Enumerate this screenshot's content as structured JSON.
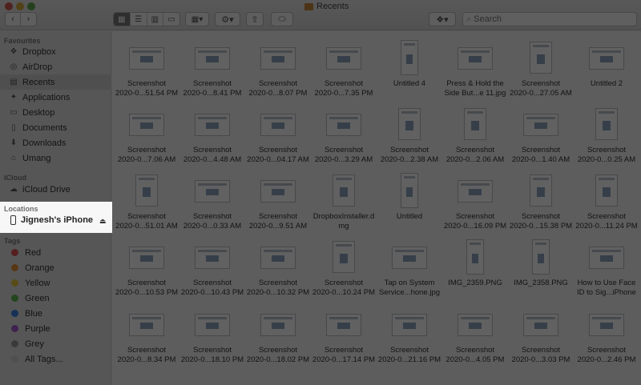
{
  "window": {
    "title": "Recents"
  },
  "toolbar": {
    "back": "‹",
    "forward": "›",
    "search_placeholder": "Search"
  },
  "sidebar": {
    "favourites_header": "Favourites",
    "favourites": [
      {
        "label": "Dropbox",
        "icon": "dropbox-icon"
      },
      {
        "label": "AirDrop",
        "icon": "airdrop-icon"
      },
      {
        "label": "Recents",
        "icon": "recents-icon"
      },
      {
        "label": "Applications",
        "icon": "applications-icon"
      },
      {
        "label": "Desktop",
        "icon": "desktop-icon"
      },
      {
        "label": "Documents",
        "icon": "documents-icon"
      },
      {
        "label": "Downloads",
        "icon": "downloads-icon"
      },
      {
        "label": "Umang",
        "icon": "home-icon"
      }
    ],
    "icloud_header": "iCloud",
    "icloud": [
      {
        "label": "iCloud Drive",
        "icon": "cloud-icon"
      }
    ],
    "locations_header": "Locations",
    "locations": [
      {
        "label": "Jignesh's iPhone",
        "icon": "phone-icon"
      }
    ],
    "tags_header": "Tags",
    "tags": [
      {
        "label": "Red",
        "color": "#e05252"
      },
      {
        "label": "Orange",
        "color": "#e8923a"
      },
      {
        "label": "Yellow",
        "color": "#e6c83a"
      },
      {
        "label": "Green",
        "color": "#5cb84c"
      },
      {
        "label": "Blue",
        "color": "#3a82e0"
      },
      {
        "label": "Purple",
        "color": "#a35ad0"
      },
      {
        "label": "Grey",
        "color": "#9a9a9a"
      },
      {
        "label": "All Tags...",
        "color": "#d0d0d0"
      }
    ]
  },
  "files": [
    [
      {
        "l1": "Screenshot",
        "l2": "2020-0...51.54 PM",
        "t": "land"
      },
      {
        "l1": "Screenshot",
        "l2": "2020-0...8.41 PM",
        "t": "land"
      },
      {
        "l1": "Screenshot",
        "l2": "2020-0...8.07 PM",
        "t": "land"
      },
      {
        "l1": "Screenshot",
        "l2": "2020-0...7.35 PM",
        "t": "land"
      },
      {
        "l1": "Untitled 4",
        "l2": "",
        "t": "tall"
      },
      {
        "l1": "Press & Hold the",
        "l2": "Side But...e 11.jpg",
        "t": "land"
      },
      {
        "l1": "Screenshot",
        "l2": "2020-0...27.05 AM",
        "t": "port"
      },
      {
        "l1": "Untitled 2",
        "l2": "",
        "t": "land"
      }
    ],
    [
      {
        "l1": "Screenshot",
        "l2": "2020-0...7.06 AM",
        "t": "land"
      },
      {
        "l1": "Screenshot",
        "l2": "2020-0...4.48 AM",
        "t": "land"
      },
      {
        "l1": "Screenshot",
        "l2": "2020-0...04.17 AM",
        "t": "land"
      },
      {
        "l1": "Screenshot",
        "l2": "2020-0...3.29 AM",
        "t": "land"
      },
      {
        "l1": "Screenshot",
        "l2": "2020-0...2.38 AM",
        "t": "port"
      },
      {
        "l1": "Screenshot",
        "l2": "2020-0...2.06 AM",
        "t": "port"
      },
      {
        "l1": "Screenshot",
        "l2": "2020-0...1.40 AM",
        "t": "land"
      },
      {
        "l1": "Screenshot",
        "l2": "2020-0...0.25 AM",
        "t": "port"
      }
    ],
    [
      {
        "l1": "Screenshot",
        "l2": "2020-0...51.01 AM",
        "t": "port"
      },
      {
        "l1": "Screenshot",
        "l2": "2020-0...0.33 AM",
        "t": "land"
      },
      {
        "l1": "Screenshot",
        "l2": "2020-0...9.51 AM",
        "t": "land"
      },
      {
        "l1": "DropboxInstaller.d",
        "l2": "mg",
        "t": "port"
      },
      {
        "l1": "Untitled",
        "l2": "",
        "t": "tall"
      },
      {
        "l1": "Screenshot",
        "l2": "2020-0...16.09 PM",
        "t": "land"
      },
      {
        "l1": "Screenshot",
        "l2": "2020-0...15.38 PM",
        "t": "port"
      },
      {
        "l1": "Screenshot",
        "l2": "2020-0...11.24 PM",
        "t": "port"
      }
    ],
    [
      {
        "l1": "Screenshot",
        "l2": "2020-0...10.53 PM",
        "t": "land"
      },
      {
        "l1": "Screenshot",
        "l2": "2020-0...10.43 PM",
        "t": "land"
      },
      {
        "l1": "Screenshot",
        "l2": "2020-0...10.32 PM",
        "t": "land"
      },
      {
        "l1": "Screenshot",
        "l2": "2020-0...10.24 PM",
        "t": "port"
      },
      {
        "l1": "Tap on System",
        "l2": "Service...hone.jpg",
        "t": "land"
      },
      {
        "l1": "IMG_2359.PNG",
        "l2": "",
        "t": "tall"
      },
      {
        "l1": "IMG_2358.PNG",
        "l2": "",
        "t": "tall"
      },
      {
        "l1": "How to Use Face",
        "l2": "ID to Sig...iPhone",
        "t": "land"
      }
    ],
    [
      {
        "l1": "Screenshot",
        "l2": "2020-0...8.34 PM",
        "t": "land"
      },
      {
        "l1": "Screenshot",
        "l2": "2020-0...18.10 PM",
        "t": "land"
      },
      {
        "l1": "Screenshot",
        "l2": "2020-0...18.02 PM",
        "t": "land"
      },
      {
        "l1": "Screenshot",
        "l2": "2020-0...17.14 PM",
        "t": "land"
      },
      {
        "l1": "Screenshot",
        "l2": "2020-0...21.16 PM",
        "t": "land"
      },
      {
        "l1": "Screenshot",
        "l2": "2020-0...4.05 PM",
        "t": "land"
      },
      {
        "l1": "Screenshot",
        "l2": "2020-0...3.03 PM",
        "t": "land"
      },
      {
        "l1": "Screenshot",
        "l2": "2020-0...2.46 PM",
        "t": "land"
      }
    ]
  ]
}
